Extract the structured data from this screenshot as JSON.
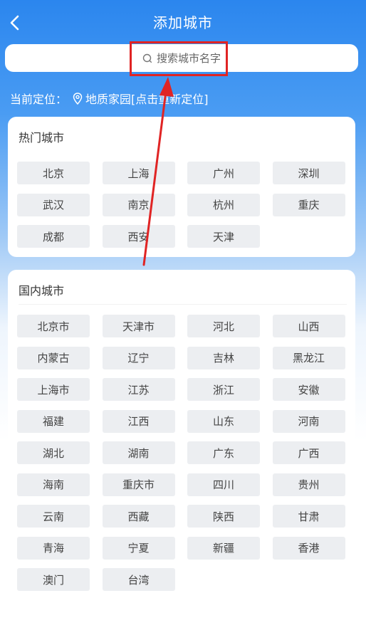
{
  "header": {
    "title": "添加城市"
  },
  "search": {
    "placeholder": "搜索城市名字"
  },
  "location": {
    "label": "当前定位：",
    "place": "地质家园[点击重新定位]"
  },
  "hot": {
    "title": "热门城市",
    "cities": [
      "北京",
      "上海",
      "广州",
      "深圳",
      "武汉",
      "南京",
      "杭州",
      "重庆",
      "成都",
      "西安",
      "天津"
    ]
  },
  "domestic": {
    "title": "国内城市",
    "cities": [
      "北京市",
      "天津市",
      "河北",
      "山西",
      "内蒙古",
      "辽宁",
      "吉林",
      "黑龙江",
      "上海市",
      "江苏",
      "浙江",
      "安徽",
      "福建",
      "江西",
      "山东",
      "河南",
      "湖北",
      "湖南",
      "广东",
      "广西",
      "海南",
      "重庆市",
      "四川",
      "贵州",
      "云南",
      "西藏",
      "陕西",
      "甘肃",
      "青海",
      "宁夏",
      "新疆",
      "香港",
      "澳门",
      "台湾"
    ]
  },
  "colors": {
    "highlight": "#e02424",
    "primary": "#2b86ee"
  }
}
